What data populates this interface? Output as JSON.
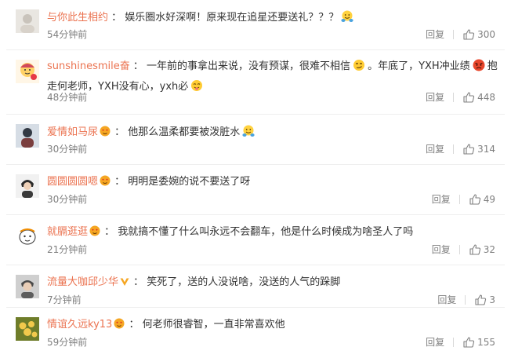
{
  "colors": {
    "username": "#eb7350",
    "text": "#333333",
    "meta": "#808080",
    "badge_gold": "#f5a623",
    "vip_orange": "#f08c00"
  },
  "comments": [
    {
      "user": "与你此生相约",
      "badge": "",
      "text": "娱乐圈水好深啊！原来现在追星还要送礼？？？",
      "emoji_after": "hug-emoji",
      "time": "54分钟前",
      "reply_label": "回复",
      "likes": "300"
    },
    {
      "user": "sunshinesmile奋",
      "badge": "",
      "text_a": "一年前的事拿出来说，没有预谋，很难不相信",
      "emoji_a": "smirk-emoji",
      "text_b": "。年底了，YXH冲业绩",
      "emoji_b": "angry-emoji",
      "text_c": "抱走何老师，YXH没有心，yxh必",
      "emoji_c": "tongue-emoji",
      "time": "48分钟前",
      "reply_label": "回复",
      "likes": "448"
    },
    {
      "user": "爱情如马尿",
      "badge": "heart-eyes-badge",
      "text": "他那么温柔都要被泼脏水",
      "emoji_after": "hug-emoji",
      "time": "30分钟前",
      "reply_label": "回复",
      "likes": "314"
    },
    {
      "user": "圆圆圆圆嗯",
      "badge": "heart-eyes-badge",
      "text": "明明是委婉的说不要送了呀",
      "time": "30分钟前",
      "reply_label": "回复",
      "likes": "49"
    },
    {
      "user": "就膈逛逛",
      "badge": "heart-eyes-badge",
      "text": "我就搞不懂了什么叫永远不会翻车，他是什么时候成为啥圣人了吗",
      "time": "21分钟前",
      "reply_label": "回复",
      "likes": "32"
    },
    {
      "user": "流量大咖邱少华",
      "badge": "vip-v-badge",
      "text": "笑死了，送的人没说啥，没送的人气的跺脚",
      "time": "7分钟前",
      "reply_label": "回复",
      "likes": "3"
    },
    {
      "user": "情谊久远ky13",
      "badge": "heart-eyes-badge",
      "text": "何老师很睿智，一直非常喜欢他",
      "time": "59分钟前",
      "reply_label": "回复",
      "likes": "155"
    }
  ]
}
